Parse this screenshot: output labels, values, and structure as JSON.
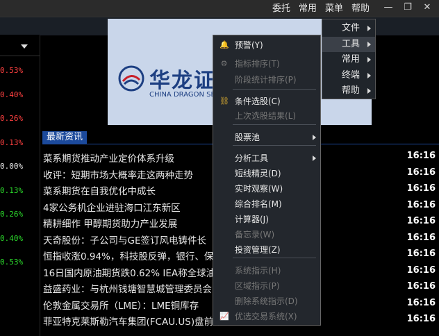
{
  "topbar": {
    "menus": [
      "委托",
      "常用",
      "菜单",
      "帮助"
    ],
    "minimize": "—",
    "restore": "❐",
    "close": "✕"
  },
  "left_percentages": [
    {
      "text": "0.53%",
      "color": "red"
    },
    {
      "text": "0.40%",
      "color": "red"
    },
    {
      "text": "0.26%",
      "color": "red"
    },
    {
      "text": "0.13%",
      "color": "red"
    },
    {
      "text": "0.00%",
      "color": "white"
    },
    {
      "text": "0.13%",
      "color": "green"
    },
    {
      "text": "0.26%",
      "color": "green"
    },
    {
      "text": "0.40%",
      "color": "green"
    },
    {
      "text": "0.53%",
      "color": "green"
    }
  ],
  "banner": {
    "brand": "华龙证",
    "sub": "CHINA DRAGON SECU"
  },
  "news": {
    "tab": "最新资讯",
    "items": [
      {
        "title": "菜系期货推动产业定价体系升级",
        "time": "16:16"
      },
      {
        "title": "收评：短期市场大概率走这两种走势",
        "time": "16:16"
      },
      {
        "title": "菜系期货在自我优化中成长",
        "time": "16:16"
      },
      {
        "title": "4家公务机企业进驻海口江东新区",
        "time": "16:16"
      },
      {
        "title": "精耕细作 甲醇期货助力产业发展",
        "time": "16:16"
      },
      {
        "title": "天奇股份：子公司与GE签订风电铸件长",
        "time": "16:16"
      },
      {
        "title": "恒指收涨0.94%，科技股反弹，银行、保",
        "time": "16:16"
      },
      {
        "title": "16日国内原油期货跌0.62% IEA称全球油",
        "time": "16:16"
      },
      {
        "title": "益盛药业：与杭州钱塘智慧城管理委员会                结……",
        "time": "16:16"
      },
      {
        "title": "伦敦金属交易所（LME）：LME铜库存",
        "time": "16:16"
      },
      {
        "title": "菲亚特克莱斯勒汽车集团(FCAU.US)盘前涨1.89%",
        "time": "16:16"
      }
    ]
  },
  "dropdown": {
    "items": [
      {
        "label": "文件",
        "selected": false
      },
      {
        "label": "工具",
        "selected": true
      },
      {
        "label": "常用",
        "selected": false
      },
      {
        "label": "终端",
        "selected": false
      },
      {
        "label": "帮助",
        "selected": false
      }
    ]
  },
  "submenu": {
    "items": [
      {
        "label": "预警(Y)",
        "enabled": true,
        "icon": "bell-icon",
        "glyph": "🔔"
      },
      {
        "label": "指标排序(T)",
        "enabled": false,
        "icon": "sort-icon",
        "glyph": "⚙"
      },
      {
        "label": "阶段统计排序(P)",
        "enabled": false,
        "icon": "",
        "glyph": ""
      },
      {
        "label": "条件选股(C)",
        "enabled": true,
        "icon": "binoculars-icon",
        "glyph": "⛓"
      },
      {
        "label": "上次选股结果(L)",
        "enabled": false,
        "icon": "",
        "glyph": ""
      },
      {
        "label": "股票池",
        "enabled": true,
        "icon": "",
        "glyph": "",
        "submenu": true
      },
      {
        "label": "分析工具",
        "enabled": true,
        "icon": "",
        "glyph": "",
        "submenu": true
      },
      {
        "label": "短线精灵(D)",
        "enabled": true,
        "icon": "",
        "glyph": ""
      },
      {
        "label": "实时观察(W)",
        "enabled": true,
        "icon": "",
        "glyph": ""
      },
      {
        "label": "综合排名(M)",
        "enabled": true,
        "icon": "",
        "glyph": ""
      },
      {
        "label": "计算器(J)",
        "enabled": true,
        "icon": "",
        "glyph": ""
      },
      {
        "label": "备忘录(W)",
        "enabled": false,
        "icon": "",
        "glyph": ""
      },
      {
        "label": "投资管理(Z)",
        "enabled": true,
        "icon": "",
        "glyph": ""
      },
      {
        "label": "系统指示(H)",
        "enabled": false,
        "icon": "",
        "glyph": ""
      },
      {
        "label": "区域指示(P)",
        "enabled": false,
        "icon": "",
        "glyph": ""
      },
      {
        "label": "删除系统指示(D)",
        "enabled": false,
        "icon": "",
        "glyph": ""
      },
      {
        "label": "优选交易系统(X)",
        "enabled": false,
        "icon": "chart-icon",
        "glyph": "📈"
      }
    ]
  },
  "colors": {
    "accent": "#1c4a9c",
    "up": "#ff4040",
    "down": "#2bd92b"
  }
}
